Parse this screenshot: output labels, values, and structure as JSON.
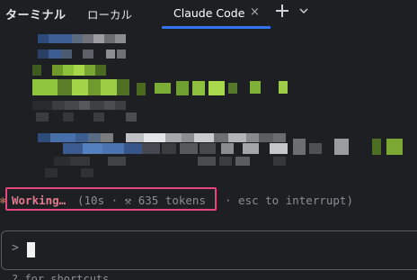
{
  "panel": {
    "title": "ターミナル"
  },
  "tabs": [
    {
      "label": "ローカル"
    },
    {
      "label": "Claude Code",
      "close_glyph": "×"
    }
  ],
  "tab_actions": {
    "new_tab_icon": "plus-icon",
    "menu_icon": "chevron-down-icon"
  },
  "status": {
    "spinner_glyph": "✻",
    "working_label": "Working…",
    "elapsed": "(10s · ⚒ 635 tokens",
    "interrupt_hint": "· esc to interrupt)"
  },
  "prompt": {
    "prompt_char": ">",
    "value": ""
  },
  "hint": {
    "text": "? for shortcuts"
  },
  "colors": {
    "accent": "#3574f0",
    "highlight": "#e8457a",
    "working": "#e07a8c",
    "spinner": "#d87757",
    "background": "#1e1f22"
  }
}
